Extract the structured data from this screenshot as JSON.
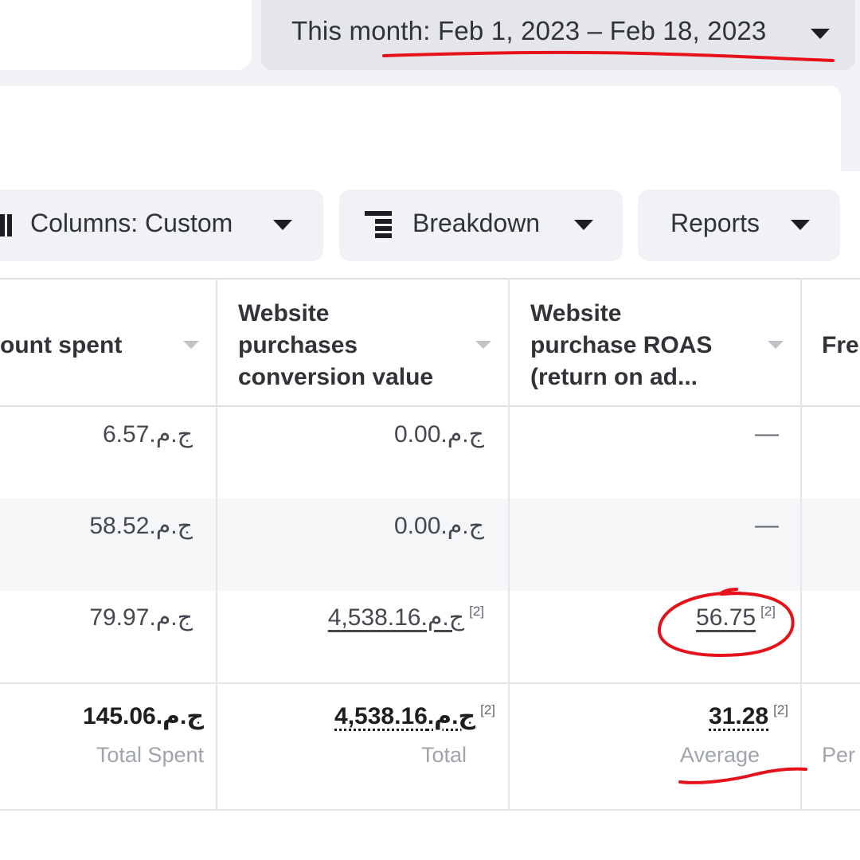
{
  "date_range": {
    "label": "This month: Feb 1, 2023 – Feb 18, 2023"
  },
  "toolbar": {
    "columns_label": "Columns: Custom",
    "breakdown_label": "Breakdown",
    "reports_label": "Reports"
  },
  "table": {
    "headers": {
      "amount_spent": "ount spent",
      "conversion_value": [
        "Website",
        "purchases",
        "conversion value"
      ],
      "roas": [
        "Website",
        "purchase ROAS",
        "(return on ad..."
      ],
      "frequency": "Fre"
    },
    "rows": [
      {
        "amount_spent": "ج.م.6.57",
        "conversion_value": "ج.م.0.00",
        "roas": "—"
      },
      {
        "amount_spent": "ج.م.58.52",
        "conversion_value": "ج.م.0.00",
        "roas": "—"
      },
      {
        "amount_spent": "ج.م.79.97",
        "conversion_value": "ج.م.4,538.16",
        "conversion_value_note": "[2]",
        "roas": "56.75",
        "roas_note": "[2]"
      }
    ],
    "totals": {
      "amount_spent": "ج.م.145.06",
      "amount_spent_label": "Total Spent",
      "conversion_value": "ج.م.4,538.16",
      "conversion_value_note": "[2]",
      "conversion_value_label": "Total",
      "roas": "31.28",
      "roas_note": "[2]",
      "roas_label": "Average",
      "frequency_label": "Per"
    }
  },
  "colors": {
    "page_bg": "#f0f2f5",
    "button_bg": "#e4e6eb",
    "stripe_bg": "#f5f6f7",
    "annotation": "#e5121b"
  },
  "icons": [
    "columns-icon",
    "breakdown-icon",
    "chevron-down-icon",
    "sort-icon"
  ]
}
